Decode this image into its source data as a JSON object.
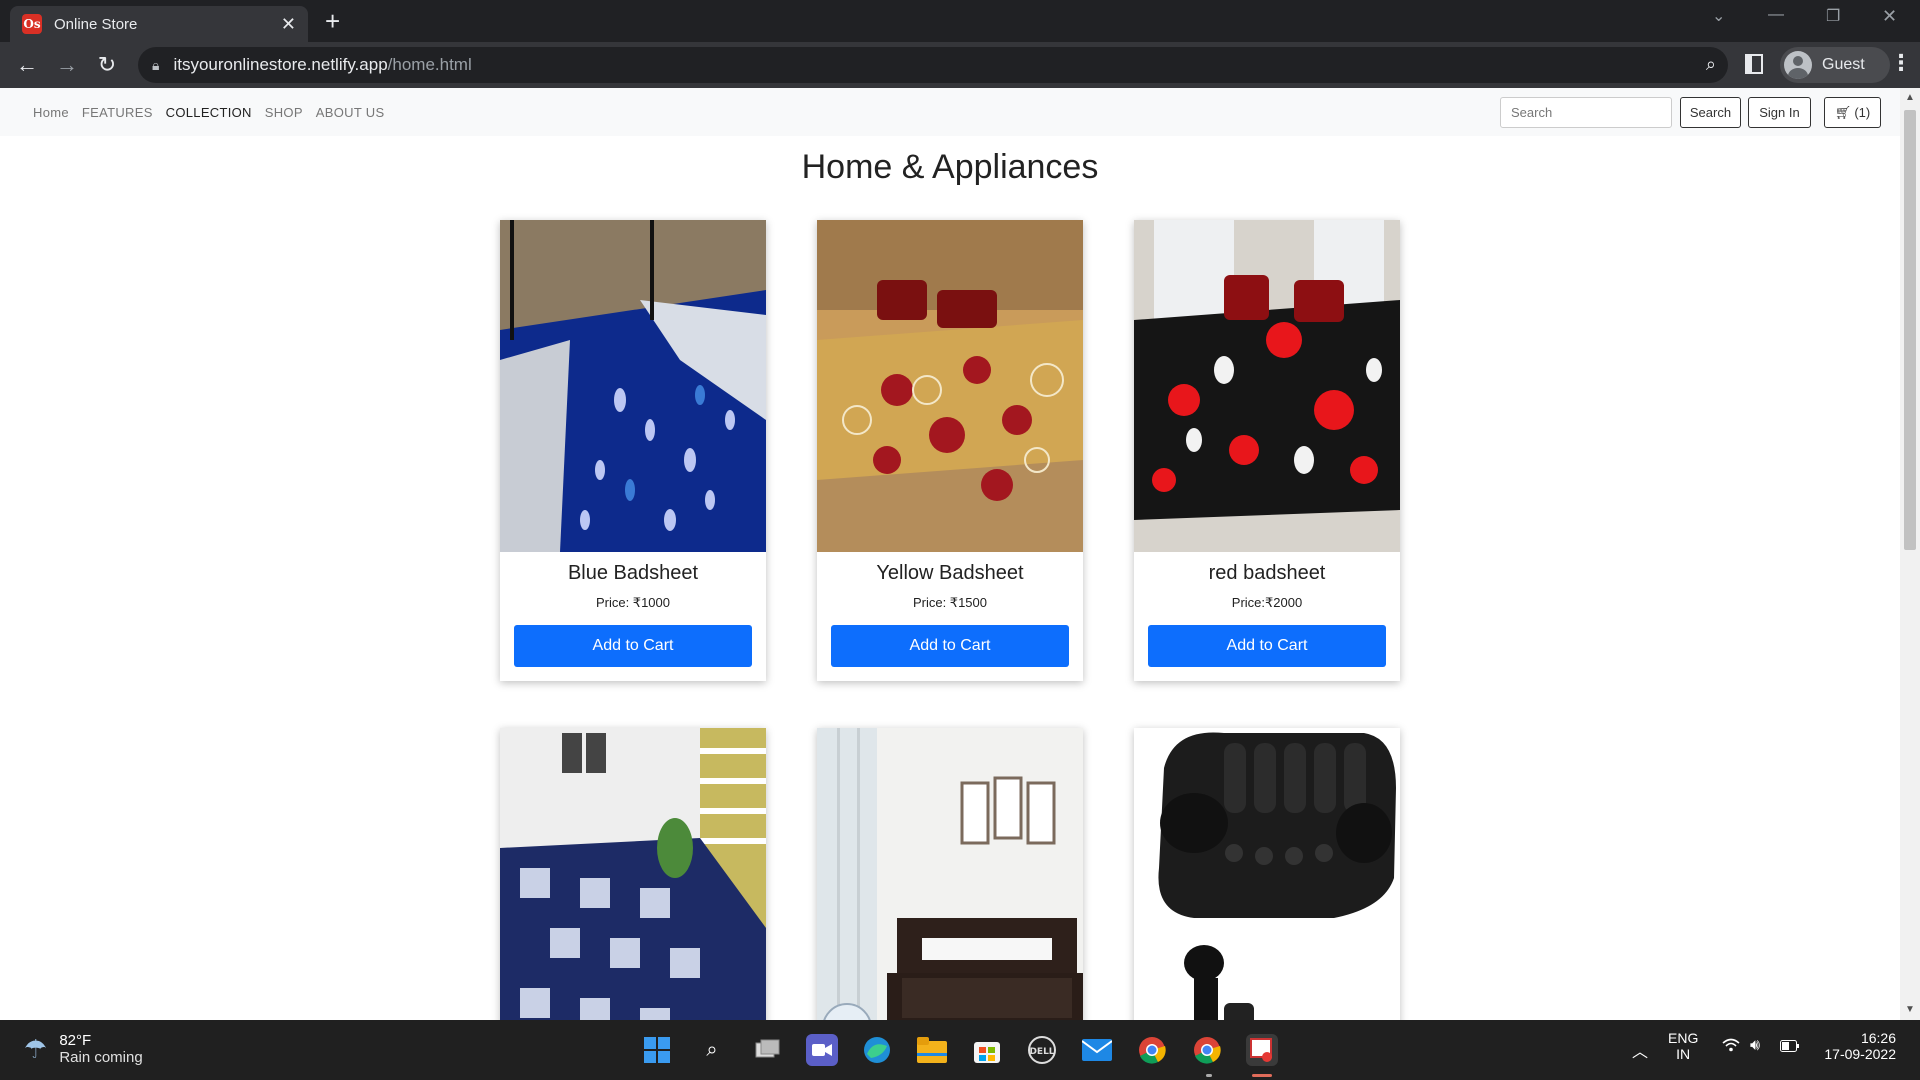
{
  "browser": {
    "tab_title": "Online Store",
    "favicon_text": "Os",
    "url_host": "itsyouronlinestore.netlify.app",
    "url_path": "/home.html",
    "profile_name": "Guest"
  },
  "site_nav": {
    "links": [
      "Home",
      "FEATURES",
      "COLLECTION",
      "SHOP",
      "ABOUT US"
    ],
    "search_placeholder": "Search",
    "search_button": "Search",
    "signin_button": "Sign In",
    "cart_label": "(1)"
  },
  "page": {
    "title": "Home & Appliances"
  },
  "products": [
    {
      "name": "Blue Badsheet",
      "price": "Price: ₹1000",
      "button": "Add to Cart"
    },
    {
      "name": "Yellow Badsheet",
      "price": "Price: ₹1500",
      "button": "Add to Cart"
    },
    {
      "name": "red badsheet",
      "price": "Price:₹2000",
      "button": "Add to Cart"
    }
  ],
  "taskbar": {
    "weather_temp": "82°F",
    "weather_desc": "Rain coming",
    "lang_1": "ENG",
    "lang_2": "IN",
    "time": "16:26",
    "date": "17-09-2022"
  },
  "colors": {
    "primary_button": "#0d6efd",
    "chrome_dark": "#202124",
    "taskbar": "#202020"
  }
}
